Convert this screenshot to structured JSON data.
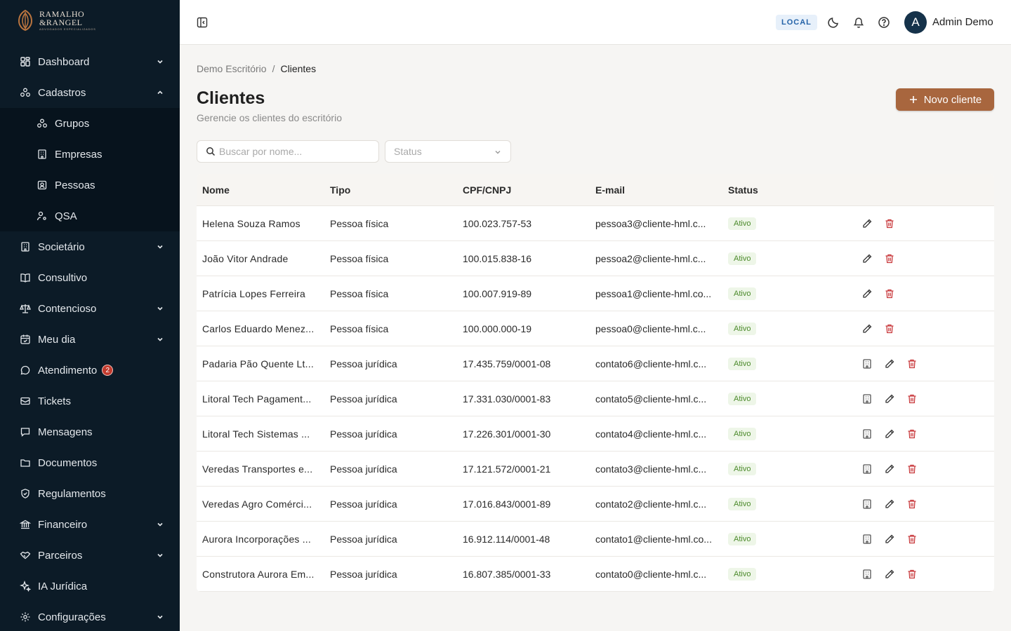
{
  "brand": {
    "line1": "RAMALHO",
    "line2": "&RANGEL",
    "tagline": "ADVOGADOS ESPECIALIZADOS"
  },
  "sidebar": {
    "items": [
      {
        "label": "Dashboard",
        "icon": "dashboard-icon",
        "expandable": true,
        "expanded": false
      },
      {
        "label": "Cadastros",
        "icon": "groups-icon",
        "expandable": true,
        "expanded": true,
        "children": [
          {
            "label": "Grupos",
            "icon": "groups-icon"
          },
          {
            "label": "Empresas",
            "icon": "building-icon"
          },
          {
            "label": "Pessoas",
            "icon": "contact-icon"
          },
          {
            "label": "QSA",
            "icon": "user-cog-icon"
          }
        ]
      },
      {
        "label": "Societário",
        "icon": "building-icon",
        "expandable": true
      },
      {
        "label": "Consultivo",
        "icon": "book-icon",
        "expandable": false
      },
      {
        "label": "Contencioso",
        "icon": "scale-icon",
        "expandable": true
      },
      {
        "label": "Meu dia",
        "icon": "calendar-icon",
        "expandable": true
      },
      {
        "label": "Atendimento",
        "icon": "chat-icon",
        "expandable": false,
        "badge": "2"
      },
      {
        "label": "Tickets",
        "icon": "ticket-icon",
        "expandable": false
      },
      {
        "label": "Mensagens",
        "icon": "message-icon",
        "expandable": false
      },
      {
        "label": "Documentos",
        "icon": "folder-icon",
        "expandable": false
      },
      {
        "label": "Regulamentos",
        "icon": "shield-icon",
        "expandable": false
      },
      {
        "label": "Financeiro",
        "icon": "bank-icon",
        "expandable": true
      },
      {
        "label": "Parceiros",
        "icon": "handshake-icon",
        "expandable": true
      },
      {
        "label": "IA Jurídica",
        "icon": "sparkles-icon",
        "expandable": false
      },
      {
        "label": "Configurações",
        "icon": "gear-icon",
        "expandable": true
      }
    ]
  },
  "header": {
    "env": "LOCAL",
    "avatar_initial": "A",
    "user_name": "Admin Demo"
  },
  "breadcrumb": {
    "root": "Demo Escritório",
    "sep": "/",
    "current": "Clientes"
  },
  "page": {
    "title": "Clientes",
    "subtitle": "Gerencie os clientes do escritório",
    "new_button": "Novo cliente"
  },
  "filters": {
    "search_placeholder": "Buscar por nome...",
    "status_placeholder": "Status"
  },
  "table": {
    "columns": [
      "Nome",
      "Tipo",
      "CPF/CNPJ",
      "E-mail",
      "Status"
    ],
    "rows": [
      {
        "nome": "Helena Souza Ramos",
        "tipo": "Pessoa física",
        "doc": "100.023.757-53",
        "email": "pessoa3@cliente-hml.c...",
        "status": "Ativo",
        "company": false
      },
      {
        "nome": "João Vitor Andrade",
        "tipo": "Pessoa física",
        "doc": "100.015.838-16",
        "email": "pessoa2@cliente-hml.c...",
        "status": "Ativo",
        "company": false
      },
      {
        "nome": "Patrícia Lopes Ferreira",
        "tipo": "Pessoa física",
        "doc": "100.007.919-89",
        "email": "pessoa1@cliente-hml.co...",
        "status": "Ativo",
        "company": false
      },
      {
        "nome": "Carlos Eduardo Menez...",
        "tipo": "Pessoa física",
        "doc": "100.000.000-19",
        "email": "pessoa0@cliente-hml.c...",
        "status": "Ativo",
        "company": false
      },
      {
        "nome": "Padaria Pão Quente Lt...",
        "tipo": "Pessoa jurídica",
        "doc": "17.435.759/0001-08",
        "email": "contato6@cliente-hml.c...",
        "status": "Ativo",
        "company": true
      },
      {
        "nome": "Litoral Tech Pagament...",
        "tipo": "Pessoa jurídica",
        "doc": "17.331.030/0001-83",
        "email": "contato5@cliente-hml.c...",
        "status": "Ativo",
        "company": true
      },
      {
        "nome": "Litoral Tech Sistemas ...",
        "tipo": "Pessoa jurídica",
        "doc": "17.226.301/0001-30",
        "email": "contato4@cliente-hml.c...",
        "status": "Ativo",
        "company": true
      },
      {
        "nome": "Veredas Transportes e...",
        "tipo": "Pessoa jurídica",
        "doc": "17.121.572/0001-21",
        "email": "contato3@cliente-hml.c...",
        "status": "Ativo",
        "company": true
      },
      {
        "nome": "Veredas Agro Comérci...",
        "tipo": "Pessoa jurídica",
        "doc": "17.016.843/0001-89",
        "email": "contato2@cliente-hml.c...",
        "status": "Ativo",
        "company": true
      },
      {
        "nome": "Aurora Incorporações ...",
        "tipo": "Pessoa jurídica",
        "doc": "16.912.114/0001-48",
        "email": "contato1@cliente-hml.co...",
        "status": "Ativo",
        "company": true
      },
      {
        "nome": "Construtora Aurora Em...",
        "tipo": "Pessoa jurídica",
        "doc": "16.807.385/0001-33",
        "email": "contato0@cliente-hml.c...",
        "status": "Ativo",
        "company": true
      }
    ]
  },
  "colors": {
    "sidebar_bg": "#0c1b27",
    "accent": "#a8663e",
    "status_green": "#4b8a2a",
    "danger": "#c8373a"
  }
}
